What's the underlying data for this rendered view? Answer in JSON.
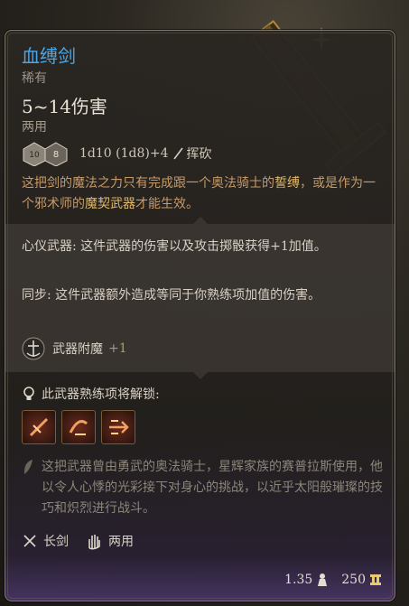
{
  "item": {
    "name": "血缚剑",
    "rarity": "稀有",
    "damage": "5~14伤害",
    "handedness": "两用",
    "dice_text": "1d10 (1d8)+4",
    "damage_type": "挥砍",
    "description_parts": [
      "这把剑的魔法之力只有完成跟一个奥法骑士的",
      "誓缚",
      "，或是作为一个邪术师的",
      "魔契武器",
      "才能生效。"
    ]
  },
  "passives": [
    {
      "name": "心仪武器",
      "text": ": 这件武器的伤害以及攻击掷骰获得+1加值。"
    },
    {
      "name": "同步",
      "text": ": 这件武器额外造成等同于你熟练项加值的伤害。"
    }
  ],
  "enchant": {
    "label": "武器附魔",
    "value": "+1"
  },
  "proficiency": {
    "title": "此武器熟练项将解锁:",
    "icons": [
      "piercing-strike-icon",
      "cleave-icon",
      "flourish-icon"
    ]
  },
  "lore": "这把武器曾由勇武的奥法骑士，星辉家族的赛普拉斯使用，他以令人心悸的光彩接下对身心的挑战，以近乎太阳般璀璨的技巧和炽烈进行战斗。",
  "tags": [
    {
      "icon": "longsword-icon",
      "label": "长剑"
    },
    {
      "icon": "hand-icon",
      "label": "两用"
    }
  ],
  "footer": {
    "weight": "1.35",
    "value": "250"
  },
  "colors": {
    "name": "#4aa6e6",
    "highlight": "#e2b865",
    "description": "#c79a66",
    "border": "#8a7a5a"
  }
}
